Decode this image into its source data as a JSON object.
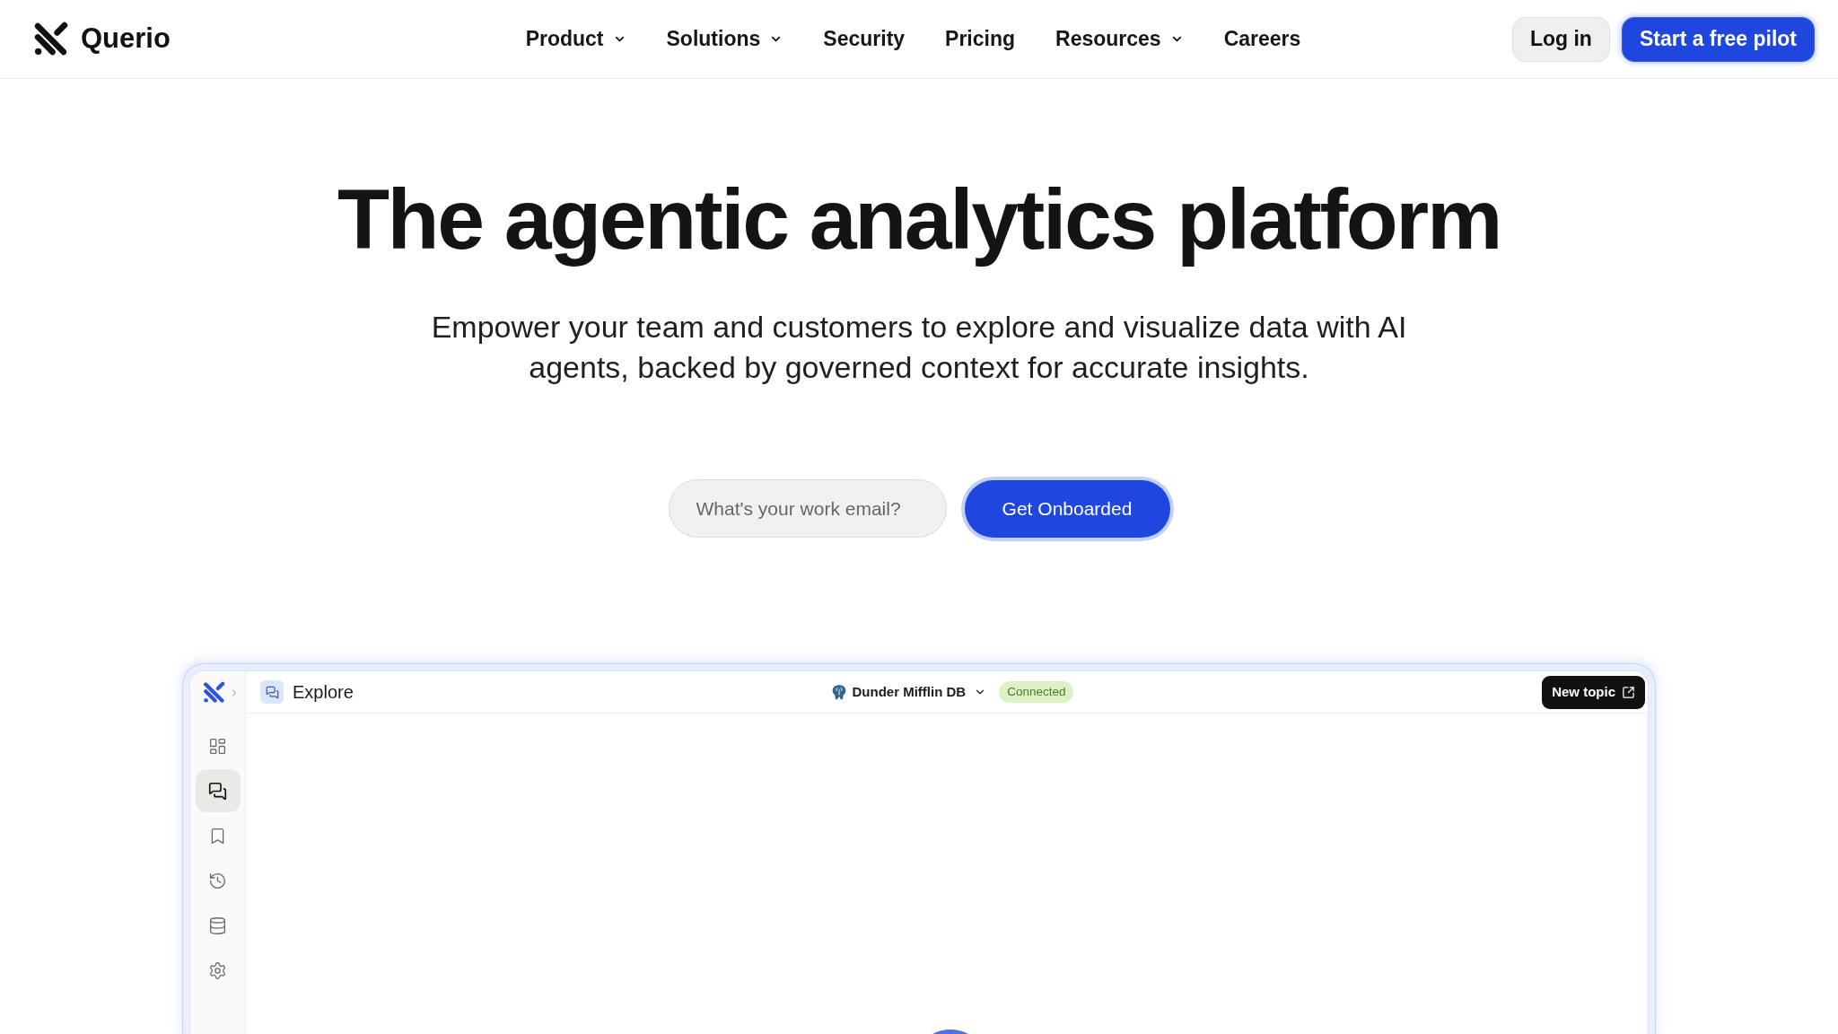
{
  "header": {
    "brand": "Querio",
    "nav": [
      {
        "label": "Product",
        "has_menu": true
      },
      {
        "label": "Solutions",
        "has_menu": true
      },
      {
        "label": "Security",
        "has_menu": false
      },
      {
        "label": "Pricing",
        "has_menu": false
      },
      {
        "label": "Resources",
        "has_menu": true
      },
      {
        "label": "Careers",
        "has_menu": false
      }
    ],
    "login": "Log in",
    "cta": "Start a free pilot"
  },
  "hero": {
    "title": "The agentic analytics platform",
    "subtitle": "Empower your team and customers to explore and visualize data with AI agents, backed by governed context for accurate insights.",
    "email": {
      "placeholder": "What's your work email?"
    },
    "submit": "Get Onboarded"
  },
  "app_preview": {
    "sidebar": [
      {
        "kind": "dashboard",
        "selected": false
      },
      {
        "kind": "chat",
        "selected": true
      },
      {
        "kind": "bookmark",
        "selected": false
      },
      {
        "kind": "history",
        "selected": false
      },
      {
        "kind": "database",
        "selected": false
      },
      {
        "kind": "settings",
        "selected": false
      }
    ],
    "page_title": "Explore",
    "database": "Dunder Mifflin DB",
    "status": "Connected",
    "new_topic": "New topic"
  }
}
